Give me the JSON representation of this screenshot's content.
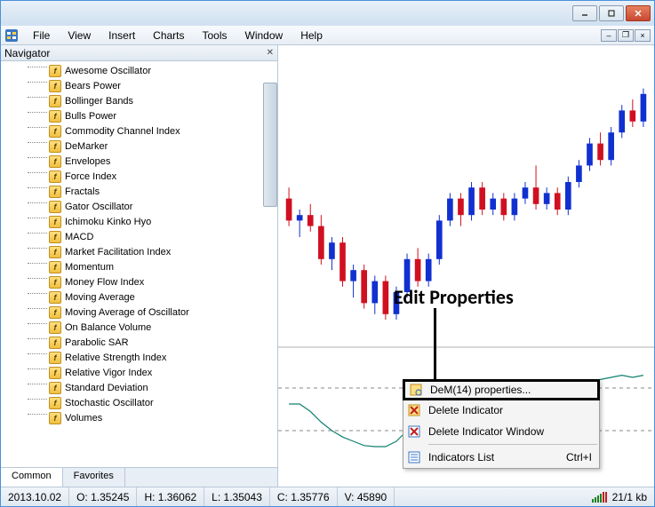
{
  "menubar": [
    "File",
    "View",
    "Insert",
    "Charts",
    "Tools",
    "Window",
    "Help"
  ],
  "navigator": {
    "title": "Navigator",
    "items": [
      "Awesome Oscillator",
      "Bears Power",
      "Bollinger Bands",
      "Bulls Power",
      "Commodity Channel Index",
      "DeMarker",
      "Envelopes",
      "Force Index",
      "Fractals",
      "Gator Oscillator",
      "Ichimoku Kinko Hyo",
      "MACD",
      "Market Facilitation Index",
      "Momentum",
      "Money Flow Index",
      "Moving Average",
      "Moving Average of Oscillator",
      "On Balance Volume",
      "Parabolic SAR",
      "Relative Strength Index",
      "Relative Vigor Index",
      "Standard Deviation",
      "Stochastic Oscillator",
      "Volumes"
    ],
    "tabs": [
      "Common",
      "Favorites"
    ]
  },
  "annotation": "Edit Properties",
  "contextmenu": {
    "properties": "DeM(14) properties...",
    "delete_ind": "Delete Indicator",
    "delete_win": "Delete Indicator Window",
    "list": "Indicators List",
    "list_sc": "Ctrl+I"
  },
  "status": {
    "date": "2013.10.02",
    "O": "O: 1.35245",
    "H": "H: 1.36062",
    "L": "L: 1.35043",
    "C": "C: 1.35776",
    "V": "V: 45890",
    "net": "21/1 kb"
  },
  "chart_data": {
    "type": "candlestick",
    "note": "Approximate candle extents read from chart (price axis not labeled; values are relative pixel-domain estimates on a 0–100 scale, low→high). Indicator subwindow is DeMarker(14) oscillator with dashed bounds.",
    "candles": [
      {
        "o": 54,
        "h": 58,
        "l": 44,
        "c": 46,
        "color": "red"
      },
      {
        "o": 46,
        "h": 50,
        "l": 40,
        "c": 48,
        "color": "blue"
      },
      {
        "o": 48,
        "h": 52,
        "l": 42,
        "c": 44,
        "color": "red"
      },
      {
        "o": 44,
        "h": 48,
        "l": 30,
        "c": 32,
        "color": "red"
      },
      {
        "o": 32,
        "h": 40,
        "l": 28,
        "c": 38,
        "color": "blue"
      },
      {
        "o": 38,
        "h": 40,
        "l": 22,
        "c": 24,
        "color": "red"
      },
      {
        "o": 24,
        "h": 30,
        "l": 18,
        "c": 28,
        "color": "blue"
      },
      {
        "o": 28,
        "h": 30,
        "l": 14,
        "c": 16,
        "color": "red"
      },
      {
        "o": 16,
        "h": 26,
        "l": 12,
        "c": 24,
        "color": "blue"
      },
      {
        "o": 24,
        "h": 26,
        "l": 10,
        "c": 12,
        "color": "red"
      },
      {
        "o": 12,
        "h": 22,
        "l": 10,
        "c": 20,
        "color": "blue"
      },
      {
        "o": 20,
        "h": 34,
        "l": 18,
        "c": 32,
        "color": "blue"
      },
      {
        "o": 32,
        "h": 36,
        "l": 22,
        "c": 24,
        "color": "red"
      },
      {
        "o": 24,
        "h": 34,
        "l": 22,
        "c": 32,
        "color": "blue"
      },
      {
        "o": 32,
        "h": 48,
        "l": 30,
        "c": 46,
        "color": "blue"
      },
      {
        "o": 46,
        "h": 56,
        "l": 44,
        "c": 54,
        "color": "blue"
      },
      {
        "o": 54,
        "h": 56,
        "l": 44,
        "c": 48,
        "color": "red"
      },
      {
        "o": 48,
        "h": 60,
        "l": 46,
        "c": 58,
        "color": "blue"
      },
      {
        "o": 58,
        "h": 60,
        "l": 48,
        "c": 50,
        "color": "red"
      },
      {
        "o": 50,
        "h": 56,
        "l": 48,
        "c": 54,
        "color": "blue"
      },
      {
        "o": 54,
        "h": 56,
        "l": 46,
        "c": 48,
        "color": "red"
      },
      {
        "o": 48,
        "h": 56,
        "l": 46,
        "c": 54,
        "color": "blue"
      },
      {
        "o": 54,
        "h": 60,
        "l": 52,
        "c": 58,
        "color": "blue"
      },
      {
        "o": 58,
        "h": 66,
        "l": 50,
        "c": 52,
        "color": "red"
      },
      {
        "o": 52,
        "h": 58,
        "l": 50,
        "c": 56,
        "color": "blue"
      },
      {
        "o": 56,
        "h": 58,
        "l": 48,
        "c": 50,
        "color": "red"
      },
      {
        "o": 50,
        "h": 62,
        "l": 48,
        "c": 60,
        "color": "blue"
      },
      {
        "o": 60,
        "h": 68,
        "l": 58,
        "c": 66,
        "color": "blue"
      },
      {
        "o": 66,
        "h": 76,
        "l": 64,
        "c": 74,
        "color": "blue"
      },
      {
        "o": 74,
        "h": 78,
        "l": 66,
        "c": 68,
        "color": "red"
      },
      {
        "o": 68,
        "h": 80,
        "l": 66,
        "c": 78,
        "color": "blue"
      },
      {
        "o": 78,
        "h": 88,
        "l": 76,
        "c": 86,
        "color": "blue"
      },
      {
        "o": 86,
        "h": 90,
        "l": 80,
        "c": 82,
        "color": "red"
      },
      {
        "o": 82,
        "h": 94,
        "l": 80,
        "c": 92,
        "color": "blue"
      }
    ],
    "indicator": {
      "name": "DeM(14)",
      "bounds_dashed": [
        0.3,
        0.7
      ],
      "values": [
        0.55,
        0.55,
        0.48,
        0.38,
        0.3,
        0.24,
        0.2,
        0.16,
        0.15,
        0.15,
        0.2,
        0.3,
        0.42,
        0.55,
        0.62,
        0.68,
        0.68,
        0.7,
        0.66,
        0.62,
        0.58,
        0.58,
        0.62,
        0.66,
        0.62,
        0.6,
        0.64,
        0.7,
        0.76,
        0.78,
        0.8,
        0.82,
        0.8,
        0.82
      ]
    }
  }
}
